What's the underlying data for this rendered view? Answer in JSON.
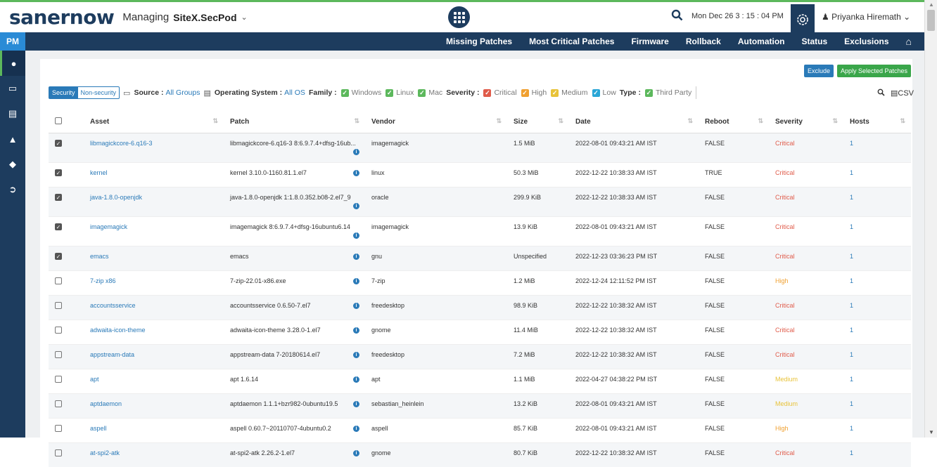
{
  "header": {
    "brand": "sanernow",
    "managing_label": "Managing",
    "site_name": "SiteX.SecPod",
    "datetime": "Mon Dec 26  3 : 15 : 04 PM",
    "user_name": "Priyanka Hiremath"
  },
  "sidebar": {
    "module": "PM",
    "items": [
      "eye-icon",
      "monitor-icon",
      "document-icon",
      "alert-icon",
      "tag-icon",
      "logout-icon"
    ]
  },
  "nav": {
    "items": [
      "Missing Patches",
      "Most Critical Patches",
      "Firmware",
      "Rollback",
      "Automation",
      "Status",
      "Exclusions"
    ]
  },
  "actions": {
    "exclude": "Exclude",
    "apply": "Apply Selected Patches"
  },
  "filters": {
    "security": "Security",
    "non_security": "Non-security",
    "source_label": "Source :",
    "source_value": "All Groups",
    "os_label": "Operating System :",
    "os_value": "All OS",
    "family_label": "Family :",
    "family": [
      "Windows",
      "Linux",
      "Mac"
    ],
    "severity_label": "Severity :",
    "severity": [
      "Critical",
      "High",
      "Medium",
      "Low"
    ],
    "type_label": "Type :",
    "type": [
      "Third Party"
    ],
    "csv": "CSV"
  },
  "colors": {
    "navy": "#1d3c5e",
    "accent_blue": "#2a7ab8",
    "green": "#5cb85c",
    "critical": "#e05b4a",
    "high": "#f0a030",
    "medium": "#e8c33a",
    "low": "#2aa6d6"
  },
  "table": {
    "columns": [
      "Asset",
      "Patch",
      "Vendor",
      "Size",
      "Date",
      "Reboot",
      "Severity",
      "Hosts"
    ],
    "rows": [
      {
        "checked": true,
        "asset": "libmagickcore-6.q16-3",
        "patch": "libmagickcore-6.q16-3 8:6.9.7.4+dfsg-16ub...",
        "vendor": "imagemagick",
        "size": "1.5 MiB",
        "date": "2022-08-01 09:43:21 AM IST",
        "reboot": "FALSE",
        "severity": "Critical",
        "hosts": "1"
      },
      {
        "checked": true,
        "asset": "kernel",
        "patch": "kernel 3.10.0-1160.81.1.el7",
        "vendor": "linux",
        "size": "50.3 MiB",
        "date": "2022-12-22 10:38:33 AM IST",
        "reboot": "TRUE",
        "severity": "Critical",
        "hosts": "1"
      },
      {
        "checked": true,
        "asset": "java-1.8.0-openjdk",
        "patch": "java-1.8.0-openjdk 1:1.8.0.352.b08-2.el7_9",
        "vendor": "oracle",
        "size": "299.9 KiB",
        "date": "2022-12-22 10:38:33 AM IST",
        "reboot": "FALSE",
        "severity": "Critical",
        "hosts": "1"
      },
      {
        "checked": true,
        "asset": "imagemagick",
        "patch": "imagemagick 8:6.9.7.4+dfsg-16ubuntu6.14",
        "vendor": "imagemagick",
        "size": "13.9 KiB",
        "date": "2022-08-01 09:43:21 AM IST",
        "reboot": "FALSE",
        "severity": "Critical",
        "hosts": "1"
      },
      {
        "checked": true,
        "asset": "emacs",
        "patch": "emacs",
        "vendor": "gnu",
        "size": "Unspecified",
        "date": "2022-12-23 03:36:23 PM IST",
        "reboot": "FALSE",
        "severity": "Critical",
        "hosts": "1"
      },
      {
        "checked": false,
        "asset": "7-zip x86",
        "patch": "7-zip-22.01-x86.exe",
        "vendor": "7-zip",
        "size": "1.2 MiB",
        "date": "2022-12-24 12:11:52 PM IST",
        "reboot": "FALSE",
        "severity": "High",
        "hosts": "1"
      },
      {
        "checked": false,
        "asset": "accountsservice",
        "patch": "accountsservice 0.6.50-7.el7",
        "vendor": "freedesktop",
        "size": "98.9 KiB",
        "date": "2022-12-22 10:38:32 AM IST",
        "reboot": "FALSE",
        "severity": "Critical",
        "hosts": "1"
      },
      {
        "checked": false,
        "asset": "adwaita-icon-theme",
        "patch": "adwaita-icon-theme 3.28.0-1.el7",
        "vendor": "gnome",
        "size": "11.4 MiB",
        "date": "2022-12-22 10:38:32 AM IST",
        "reboot": "FALSE",
        "severity": "Critical",
        "hosts": "1"
      },
      {
        "checked": false,
        "asset": "appstream-data",
        "patch": "appstream-data 7-20180614.el7",
        "vendor": "freedesktop",
        "size": "7.2 MiB",
        "date": "2022-12-22 10:38:32 AM IST",
        "reboot": "FALSE",
        "severity": "Critical",
        "hosts": "1"
      },
      {
        "checked": false,
        "asset": "apt",
        "patch": "apt 1.6.14",
        "vendor": "apt",
        "size": "1.1 MiB",
        "date": "2022-04-27 04:38:22 PM IST",
        "reboot": "FALSE",
        "severity": "Medium",
        "hosts": "1"
      },
      {
        "checked": false,
        "asset": "aptdaemon",
        "patch": "aptdaemon 1.1.1+bzr982-0ubuntu19.5",
        "vendor": "sebastian_heinlein",
        "size": "13.2 KiB",
        "date": "2022-08-01 09:43:21 AM IST",
        "reboot": "FALSE",
        "severity": "Medium",
        "hosts": "1"
      },
      {
        "checked": false,
        "asset": "aspell",
        "patch": "aspell 0.60.7~20110707-4ubuntu0.2",
        "vendor": "aspell",
        "size": "85.7 KiB",
        "date": "2022-08-01 09:43:21 AM IST",
        "reboot": "FALSE",
        "severity": "High",
        "hosts": "1"
      },
      {
        "checked": false,
        "asset": "at-spi2-atk",
        "patch": "at-spi2-atk 2.26.2-1.el7",
        "vendor": "gnome",
        "size": "80.7 KiB",
        "date": "2022-12-22 10:38:32 AM IST",
        "reboot": "FALSE",
        "severity": "Critical",
        "hosts": "1"
      }
    ]
  }
}
